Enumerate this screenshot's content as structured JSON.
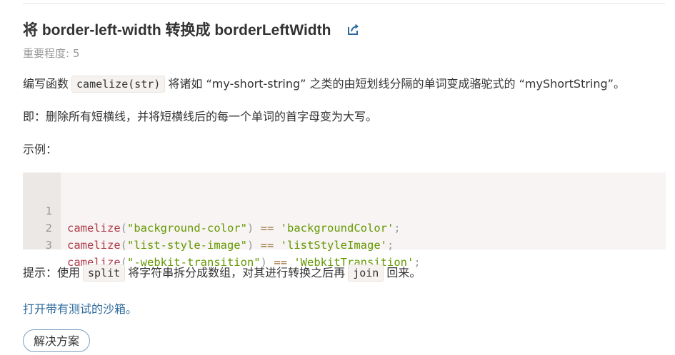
{
  "task": {
    "title": "将 border-left-width 转换成 borderLeftWidth",
    "importance": "重要程度: 5",
    "p1": {
      "pre": "编写函数",
      "code": "camelize(str)",
      "post": "将诸如 “my-short-string” 之类的由短划线分隔的单词变成骆驼式的 “myShortString”。"
    },
    "p2": "即：删除所有短横线，并将短横线后的每一个单词的首字母变为大写。",
    "p3": "示例：",
    "code_lines": [
      {
        "n": "1",
        "fn": "camelize",
        "arg": "\"background-color\"",
        "op": "==",
        "res": "'backgroundColor'"
      },
      {
        "n": "2",
        "fn": "camelize",
        "arg": "\"list-style-image\"",
        "op": "==",
        "res": "'listStyleImage'"
      },
      {
        "n": "3",
        "fn": "camelize",
        "arg": "\"-webkit-transition\"",
        "op": "==",
        "res": "'WebkitTransition'"
      }
    ],
    "hint": {
      "pre": "提示：使用",
      "code1": "split",
      "mid": "将字符串拆分成数组，对其进行转换之后再",
      "code2": "join",
      "post": "回来。"
    },
    "sandbox_link": "打开带有测试的沙箱。",
    "solution_button": "解决方案",
    "colors": {
      "link": "#2d6a9b",
      "function": "#b23a48",
      "string": "#669900",
      "operator": "#9a6e3a"
    },
    "icons": {
      "share": "share-external-icon"
    }
  }
}
